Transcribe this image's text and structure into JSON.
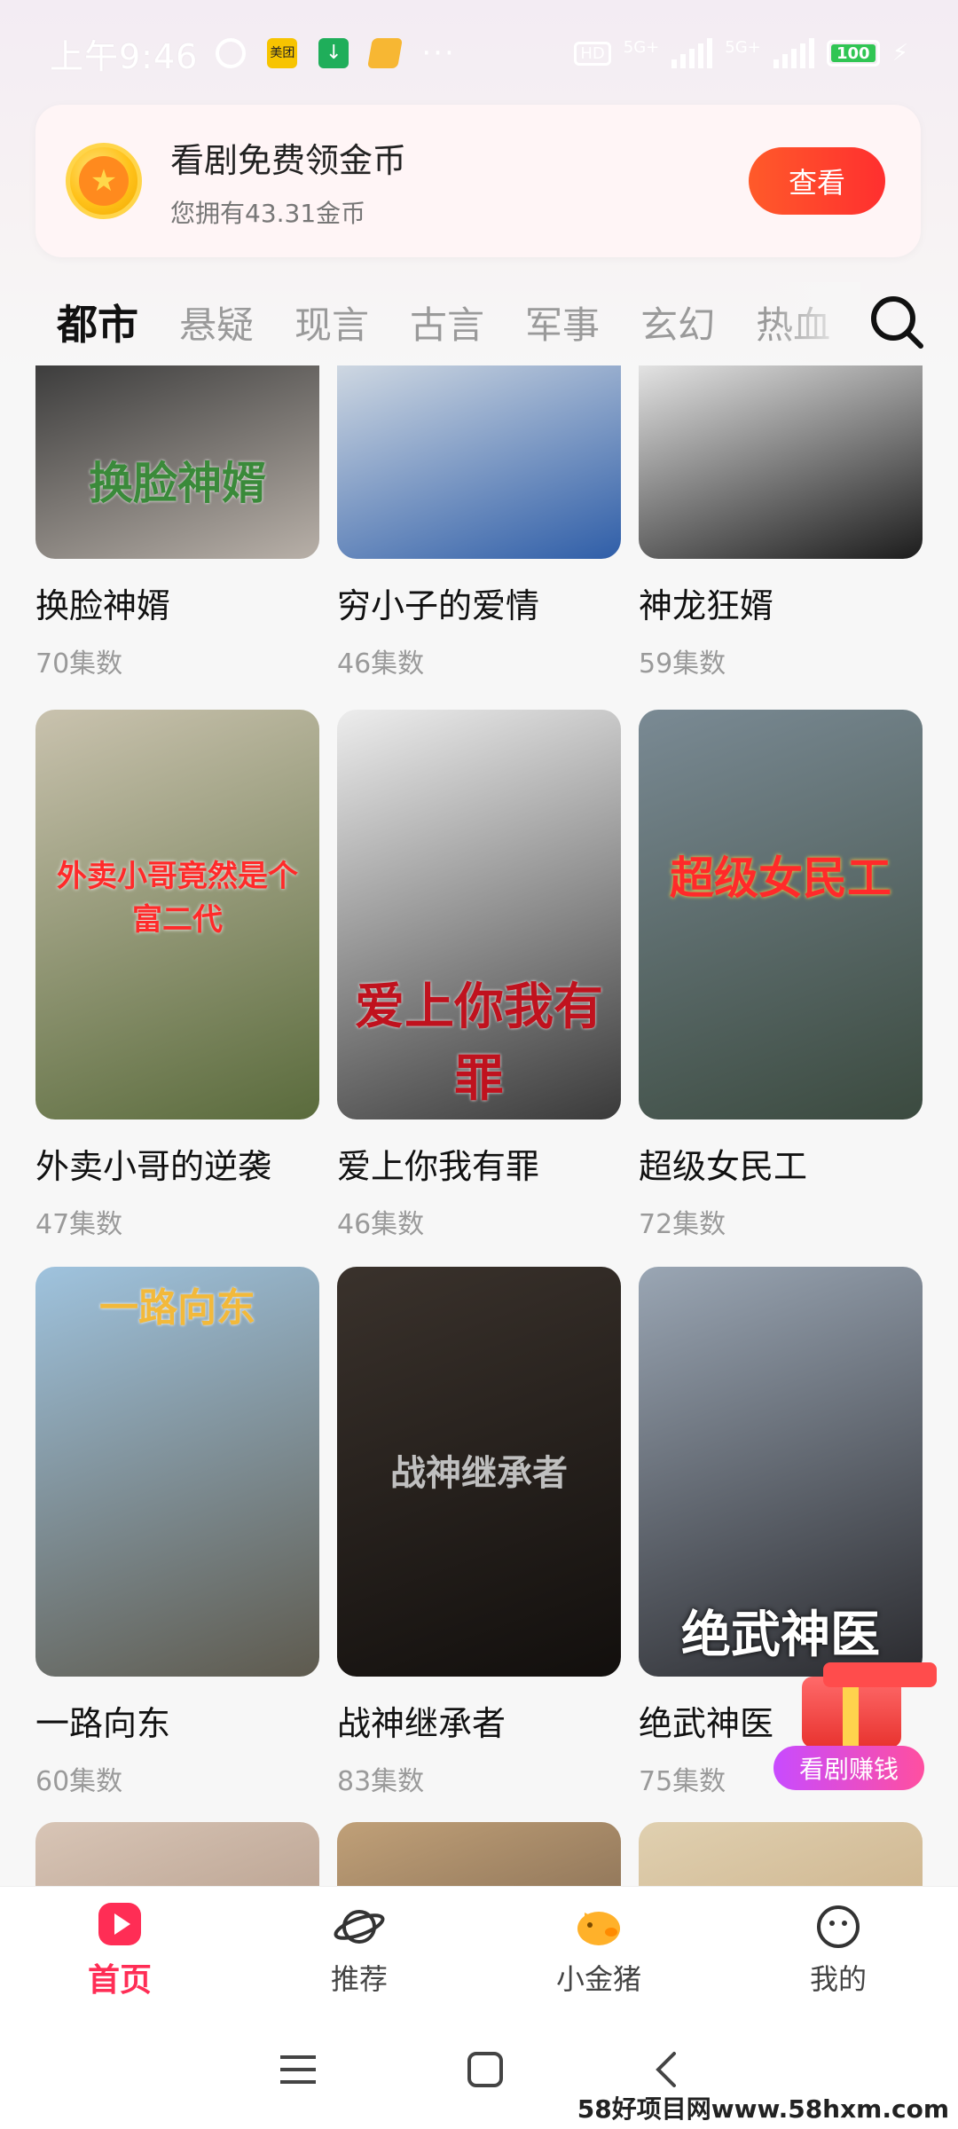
{
  "status_bar": {
    "time": "上午9:46",
    "app_icon_meituan": "美团",
    "network_hd": "HD",
    "network_1": "5G+",
    "network_2": "5G+",
    "battery": "100"
  },
  "coin_banner": {
    "title": "看剧免费领金币",
    "subtitle": "您拥有43.31金币",
    "button": "查看"
  },
  "tabs": [
    {
      "label": "都市",
      "active": true
    },
    {
      "label": "悬疑"
    },
    {
      "label": "现言"
    },
    {
      "label": "古言"
    },
    {
      "label": "军事"
    },
    {
      "label": "玄幻"
    },
    {
      "label": "热血"
    }
  ],
  "dramas": [
    {
      "title": "换脸神婿",
      "episodes": "70集数",
      "poster_text": "换脸神婿",
      "colors": [
        "#3c3c3c",
        "#b8b0a8"
      ]
    },
    {
      "title": "穷小子的爱情",
      "episodes": "46集数",
      "poster_text": "",
      "colors": [
        "#cfd8e2",
        "#2f5ea8"
      ]
    },
    {
      "title": "神龙狂婿",
      "episodes": "59集数",
      "poster_text": "",
      "colors": [
        "#e4e4e4",
        "#1c1c1c"
      ]
    },
    {
      "title": "外卖小哥的逆袭",
      "episodes": "47集数",
      "poster_text": "外卖小哥竟然是个富二代",
      "colors": [
        "#c9c2ae",
        "#5a6b3c"
      ]
    },
    {
      "title": "爱上你我有罪",
      "episodes": "46集数",
      "poster_text": "爱上你我有罪",
      "colors": [
        "#ededed",
        "#3a3a3a"
      ]
    },
    {
      "title": "超级女民工",
      "episodes": "72集数",
      "poster_text": "超级女民工",
      "colors": [
        "#7a8a94",
        "#3b4a3f"
      ]
    },
    {
      "title": "一路向东",
      "episodes": "60集数",
      "poster_text": "一路向东",
      "colors": [
        "#9fc3de",
        "#5e5a4e"
      ]
    },
    {
      "title": "战神继承者",
      "episodes": "83集数",
      "poster_text": "战神继承者",
      "colors": [
        "#3a322c",
        "#120f0d"
      ]
    },
    {
      "title": "绝武神医",
      "episodes": "75集数",
      "poster_text": "绝武神医",
      "colors": [
        "#9aa6b4",
        "#2a2a2e"
      ]
    },
    {
      "title": "",
      "episodes": "",
      "poster_text": "",
      "colors": [
        "#d8c5b6",
        "#8a6a55"
      ]
    },
    {
      "title": "",
      "episodes": "",
      "poster_text": "",
      "colors": [
        "#c0a078",
        "#3a2a22"
      ]
    },
    {
      "title": "",
      "episodes": "",
      "poster_text": "",
      "colors": [
        "#e0d0b0",
        "#b08858"
      ]
    }
  ],
  "reward_badge": {
    "label": "看剧赚钱"
  },
  "bottom_nav": [
    {
      "label": "首页",
      "icon": "play-icon",
      "active": true
    },
    {
      "label": "推荐",
      "icon": "planet-icon"
    },
    {
      "label": "小金猪",
      "icon": "piggy-bank-icon"
    },
    {
      "label": "我的",
      "icon": "smiley-icon"
    }
  ],
  "watermark": "58好项目网www.58hxm.com",
  "colors": {
    "accent": "#ff2d55",
    "coin_button": "#ff3a2f"
  }
}
